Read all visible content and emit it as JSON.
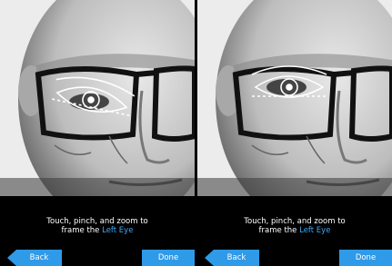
{
  "instruction": {
    "line1": "Touch, pinch, and zoom to",
    "line2_prefix": "frame the ",
    "line2_highlight": "Left Eye"
  },
  "buttons": {
    "back_label": "Back",
    "done_label": "Done"
  },
  "colors": {
    "accent": "#2f9ae8",
    "highlight_text": "#3fa9f5",
    "background": "#000000"
  },
  "icons": {
    "left_panel_overlay": "eye-frame-guide-tilted",
    "right_panel_overlay": "eye-frame-guide"
  }
}
